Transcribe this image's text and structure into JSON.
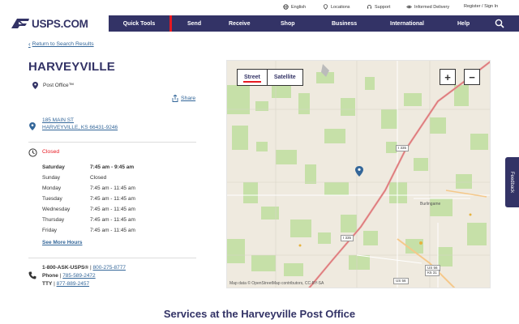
{
  "utility": {
    "english": "English",
    "locations": "Locations",
    "support": "Support",
    "informed_delivery": "Informed Delivery",
    "register": "Register / Sign In"
  },
  "logo": {
    "text": "USPS.COM"
  },
  "nav": {
    "quick_tools": "Quick Tools",
    "items": [
      "Send",
      "Receive",
      "Shop",
      "Business",
      "International",
      "Help"
    ]
  },
  "breadcrumb": "Return to Search Results",
  "title": "HARVEYVILLE",
  "po_type": "Post Office™",
  "share": "Share",
  "address": {
    "line1": "185 MAIN ST",
    "line2": "HARVEYVILLE, KS 66431-9246"
  },
  "status": "Closed",
  "hours": [
    {
      "day": "Saturday",
      "time": "7:45 am - 9:45 am"
    },
    {
      "day": "Sunday",
      "time": "Closed"
    },
    {
      "day": "Monday",
      "time": "7:45 am - 11:45 am"
    },
    {
      "day": "Tuesday",
      "time": "7:45 am - 11:45 am"
    },
    {
      "day": "Wednesday",
      "time": "7:45 am - 11:45 am"
    },
    {
      "day": "Thursday",
      "time": "7:45 am - 11:45 am"
    },
    {
      "day": "Friday",
      "time": "7:45 am - 11:45 am"
    }
  ],
  "more_hours": "See More Hours",
  "contact": {
    "ask_label": "1-800-ASK-USPS®",
    "ask_number": "800-275-8777",
    "phone_label": "Phone",
    "phone_number": "785-589-2472",
    "tty_label": "TTY",
    "tty_number": "877-889-2457"
  },
  "map": {
    "street": "Street",
    "satellite": "Satellite",
    "zoom_in": "+",
    "zoom_out": "−",
    "attribution": "Map data © OpenStreetMap contributors, CC-BY-SA",
    "town_label": "Burlingame",
    "shield_1": "I 335",
    "shield_2": "I 335",
    "shield_3": "US 56",
    "shield_4": "K5 31",
    "shield_5": "US 56"
  },
  "feedback": "Feedback",
  "services_heading": "Services at the Harveyville Post Office",
  "colors": {
    "brand_navy": "#333366",
    "accent_red": "#e71921",
    "link_blue": "#336699"
  }
}
